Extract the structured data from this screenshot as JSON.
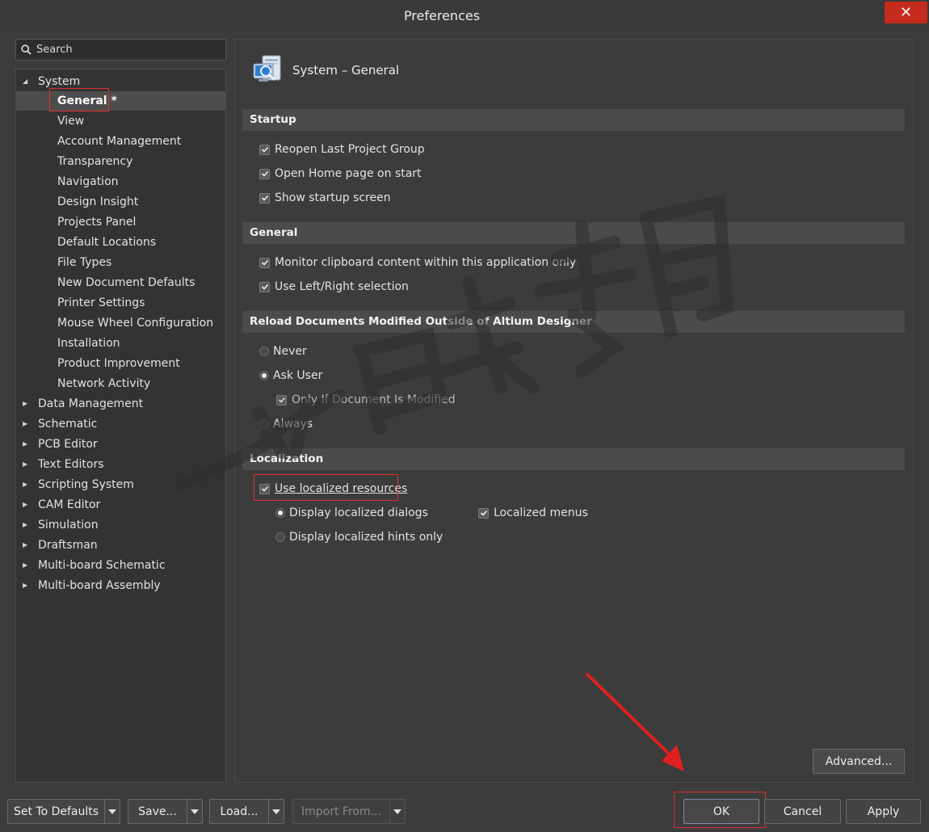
{
  "window": {
    "title": "Preferences",
    "close_glyph": "✕"
  },
  "search": {
    "placeholder": "Search",
    "value": ""
  },
  "tree": {
    "items": [
      {
        "label": "System",
        "expanded": true
      },
      {
        "label": "General *",
        "selected": true
      },
      {
        "label": "View"
      },
      {
        "label": "Account Management"
      },
      {
        "label": "Transparency"
      },
      {
        "label": "Navigation"
      },
      {
        "label": "Design Insight"
      },
      {
        "label": "Projects Panel"
      },
      {
        "label": "Default Locations"
      },
      {
        "label": "File Types"
      },
      {
        "label": "New Document Defaults"
      },
      {
        "label": "Printer Settings"
      },
      {
        "label": "Mouse Wheel Configuration"
      },
      {
        "label": "Installation"
      },
      {
        "label": "Product Improvement"
      },
      {
        "label": "Network Activity"
      },
      {
        "label": "Data Management"
      },
      {
        "label": "Schematic"
      },
      {
        "label": "PCB Editor"
      },
      {
        "label": "Text Editors"
      },
      {
        "label": "Scripting System"
      },
      {
        "label": "CAM Editor"
      },
      {
        "label": "Simulation"
      },
      {
        "label": "Draftsman"
      },
      {
        "label": "Multi-board Schematic"
      },
      {
        "label": "Multi-board Assembly"
      }
    ]
  },
  "page": {
    "title": "System – General",
    "icon": "system-general-icon"
  },
  "sections": {
    "startup": {
      "title": "Startup",
      "options": [
        {
          "label": "Reopen Last Project Group",
          "checked": true
        },
        {
          "label": "Open Home page on start",
          "checked": true
        },
        {
          "label": "Show startup screen",
          "checked": true
        }
      ]
    },
    "general": {
      "title": "General",
      "options": [
        {
          "label": "Monitor clipboard content within this application only",
          "checked": true
        },
        {
          "label": "Use Left/Right selection",
          "checked": true
        }
      ]
    },
    "reload": {
      "title": "Reload Documents Modified Outside of Altium Designer",
      "never": "Never",
      "ask_user": "Ask User",
      "only_if_modified": "Only If Document Is Modified",
      "always": "Always",
      "selected": "Ask User"
    },
    "localization": {
      "title": "Localization",
      "use_localized": "Use localized resources",
      "display_dialogs": "Display localized dialogs",
      "display_hints": "Display localized hints only",
      "localized_menus": "Localized menus"
    }
  },
  "buttons": {
    "advanced": "Advanced...",
    "set_defaults": "Set To Defaults",
    "save": "Save...",
    "load": "Load...",
    "import_from": "Import From...",
    "ok": "OK",
    "cancel": "Cancel",
    "apply": "Apply"
  },
  "colors": {
    "accent_red": "#e03030",
    "close_red": "#c42b1c",
    "panel_bg": "#3c3c3c"
  }
}
